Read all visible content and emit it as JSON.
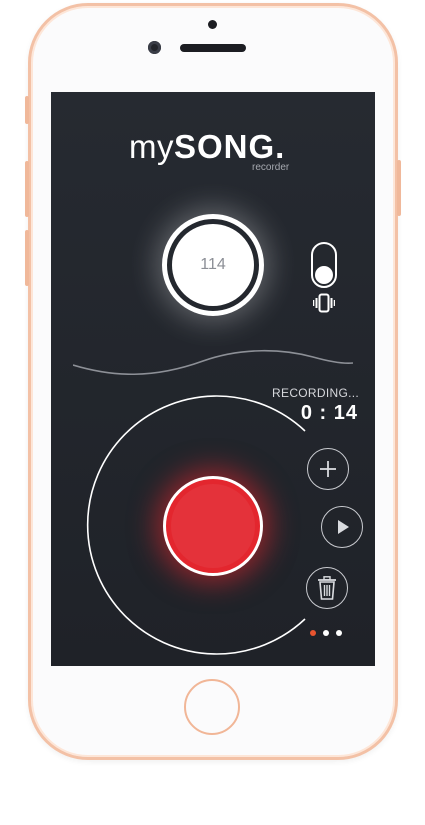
{
  "app": {
    "logo_thin": "my",
    "logo_bold": "SONG.",
    "logo_sub": "recorder"
  },
  "tempo": {
    "value": "114"
  },
  "vibrate_toggle": {
    "on": false
  },
  "recording": {
    "status": "RECORDING...",
    "time": "0 : 14"
  },
  "controls": {
    "add_icon": "plus-icon",
    "play_icon": "play-icon",
    "delete_icon": "trash-icon"
  },
  "pagination": {
    "count": 3,
    "active_index": 0
  },
  "colors": {
    "record": "#e3262e",
    "active_dot": "#e8542f",
    "background": "#22262c"
  }
}
